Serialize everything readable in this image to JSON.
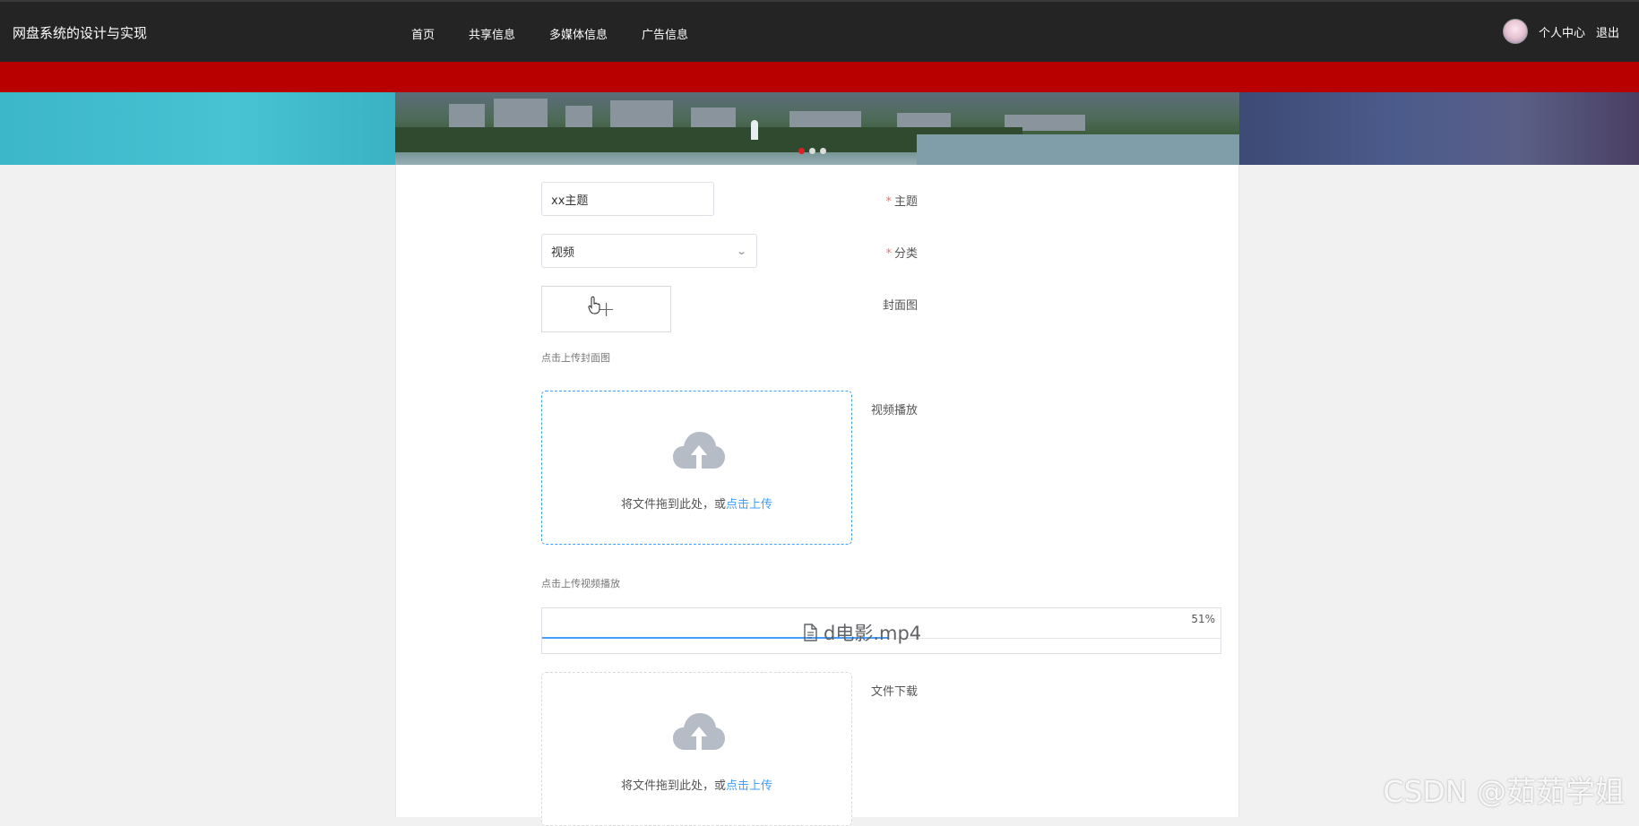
{
  "nav": {
    "brand": "网盘系统的设计与实现",
    "menu": [
      {
        "label": "首页"
      },
      {
        "label": "共享信息"
      },
      {
        "label": "多媒体信息"
      },
      {
        "label": "广告信息"
      }
    ],
    "user_center": "个人中心",
    "logout": "退出"
  },
  "form": {
    "subject": {
      "label": "主题",
      "value": "xx主题",
      "required": true
    },
    "category": {
      "label": "分类",
      "value": "视频",
      "required": true
    },
    "cover": {
      "label": "封面图",
      "tip": "点击上传封面图"
    },
    "video": {
      "label": "视频播放",
      "drag_text": "将文件拖到此处，或",
      "link_text": "点击上传",
      "tip": "点击上传视频播放",
      "file": {
        "name": "d电影.mp4",
        "progress_label": "51%",
        "progress": 0.51
      }
    },
    "download": {
      "label": "文件下载",
      "drag_text": "将文件拖到此处，或",
      "link_text": "点击上传"
    }
  },
  "watermark": "CSDN @茹茹学姐",
  "colors": {
    "accent": "#409eff",
    "nav_bg": "#242424",
    "red_bar": "#b80000",
    "required": "#f56c6c"
  }
}
